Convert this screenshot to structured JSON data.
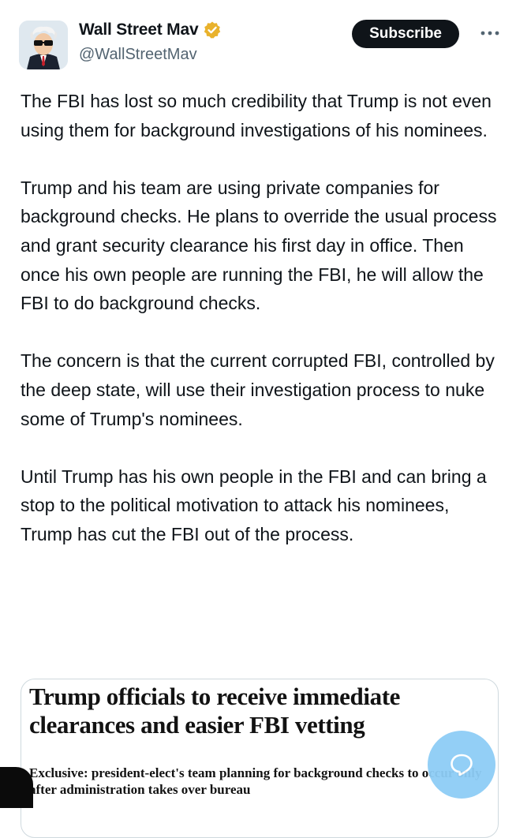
{
  "author": {
    "display_name": "Wall Street Mav",
    "handle": "@WallStreetMav",
    "verified_badge_color": "#e9b22c"
  },
  "header": {
    "subscribe_label": "Subscribe",
    "more_icon": "more-horizontal-icon"
  },
  "tweet": {
    "paragraphs": [
      "The FBI has lost so much credibility that Trump is not even using them for background investigations of his nominees.",
      "Trump and his team are using private companies for background checks. He plans to override the usual process and grant security clearance his first day in office. Then once his own people are running the FBI, he will allow the FBI to do background checks.",
      "The concern is that the current corrupted FBI, controlled by the deep state, will use their investigation process to nuke some of Trump's nominees.",
      "Until Trump has his own people in the FBI and can bring a stop to the political motivation to attack his nominees, Trump has cut the FBI out of the process."
    ]
  },
  "card": {
    "headline": "Trump officials to receive immediate clearances and easier FBI vetting",
    "subheadline": "Exclusive: president-elect's team planning for background checks to occur only after administration takes over bureau"
  },
  "fab": {
    "icon": "reply-bubble-icon",
    "color": "#8ecdf6"
  }
}
